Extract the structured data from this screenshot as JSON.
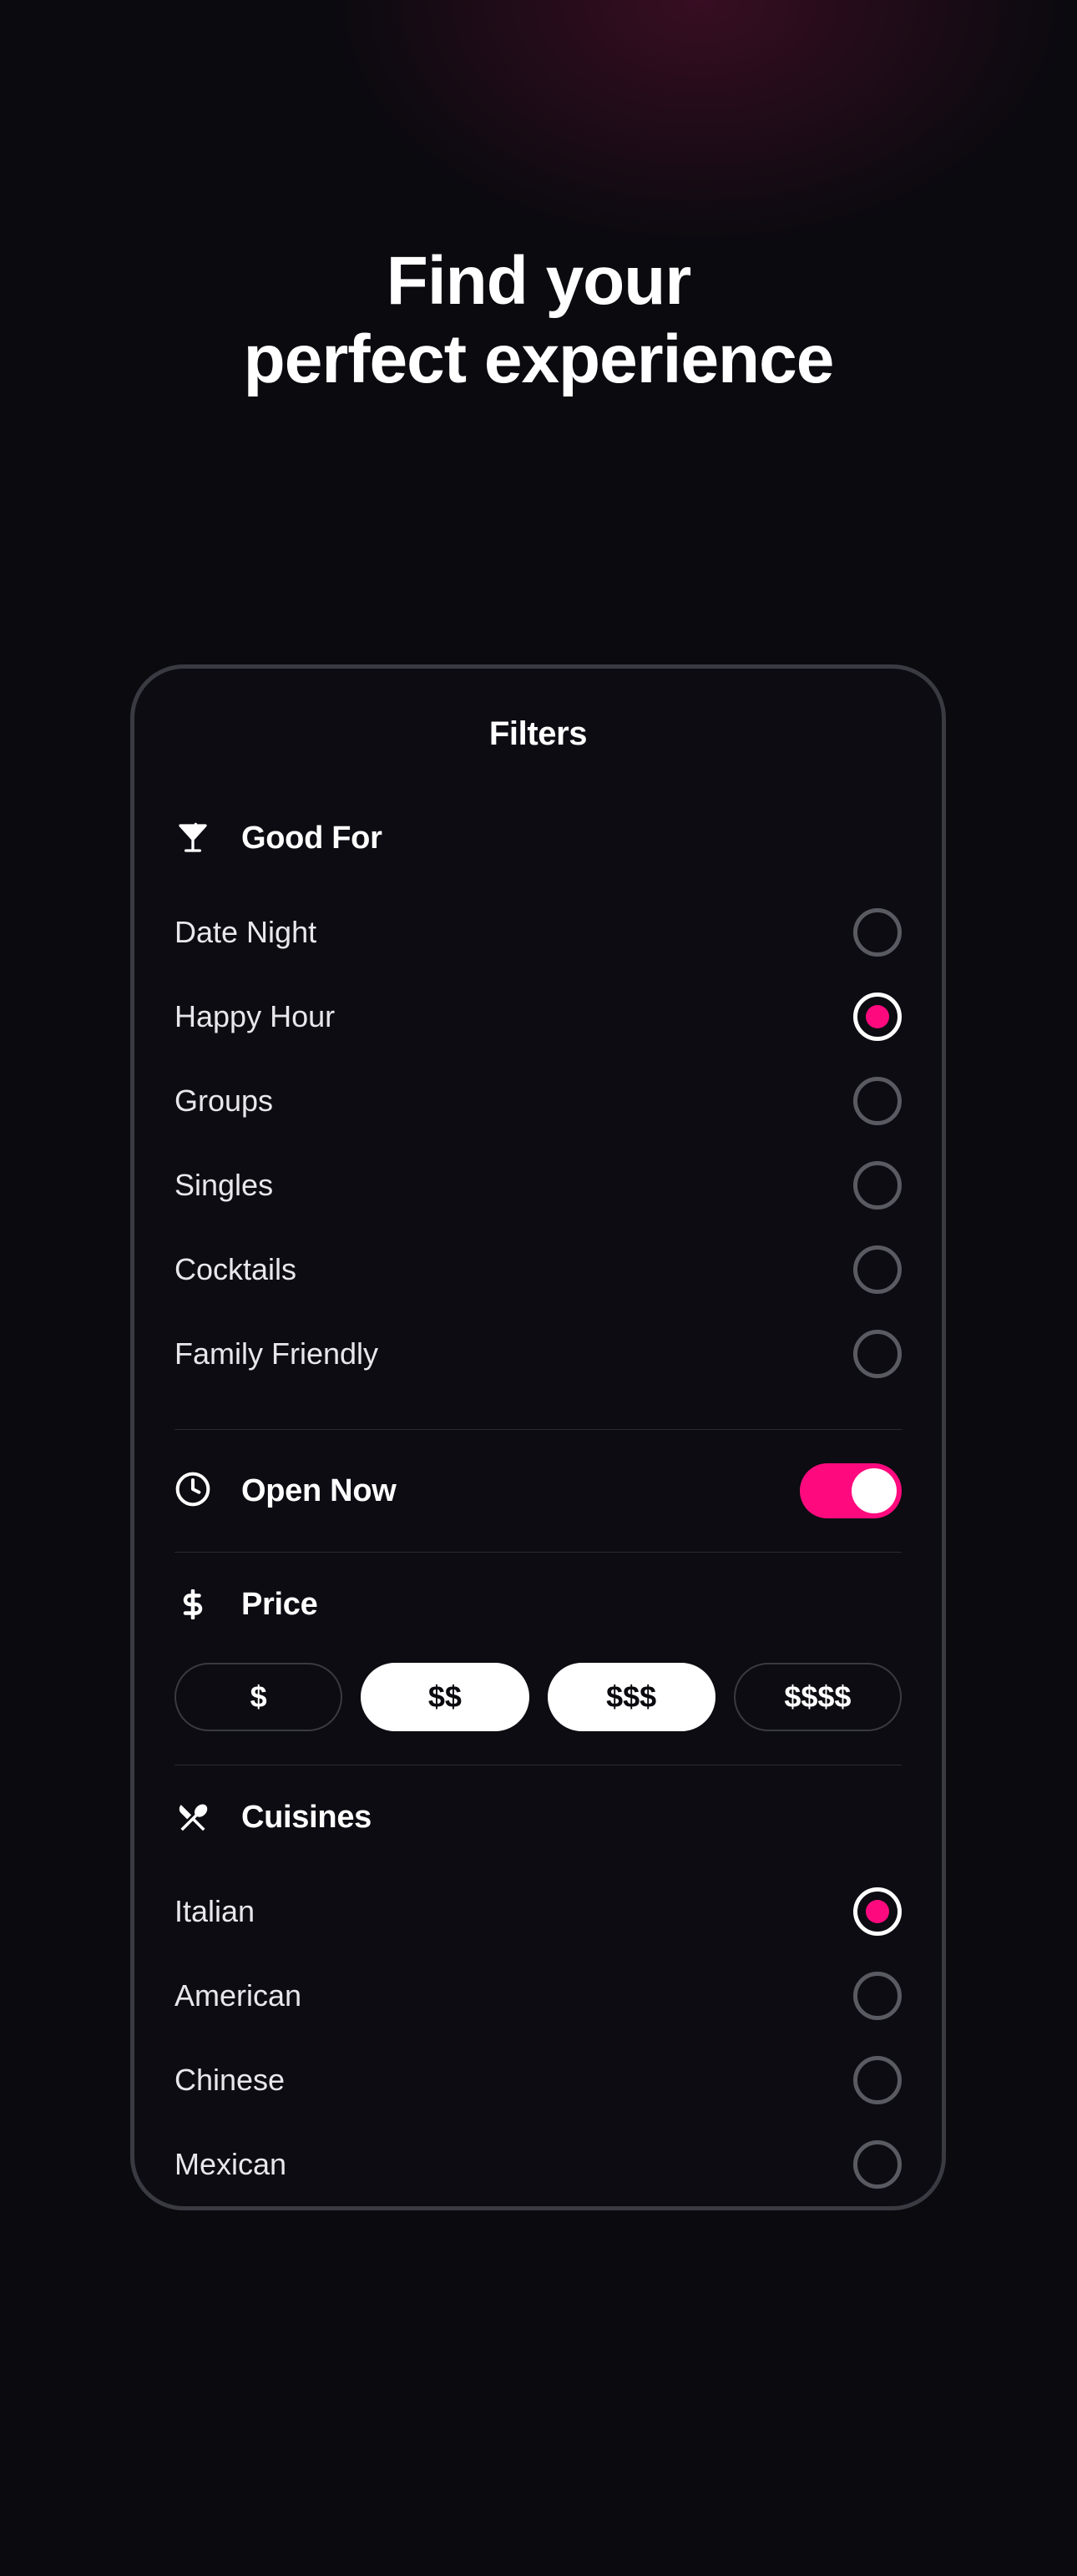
{
  "hero": {
    "line1": "Find your",
    "line2": "perfect experience"
  },
  "filters": {
    "title": "Filters",
    "goodFor": {
      "title": "Good For",
      "options": [
        {
          "label": "Date Night",
          "selected": false
        },
        {
          "label": "Happy Hour",
          "selected": true
        },
        {
          "label": "Groups",
          "selected": false
        },
        {
          "label": "Singles",
          "selected": false
        },
        {
          "label": "Cocktails",
          "selected": false
        },
        {
          "label": "Family Friendly",
          "selected": false
        }
      ]
    },
    "openNow": {
      "label": "Open Now",
      "enabled": true
    },
    "price": {
      "title": "Price",
      "options": [
        {
          "label": "$",
          "selected": false
        },
        {
          "label": "$$",
          "selected": true
        },
        {
          "label": "$$$",
          "selected": true
        },
        {
          "label": "$$$$",
          "selected": false
        }
      ]
    },
    "cuisines": {
      "title": "Cuisines",
      "options": [
        {
          "label": "Italian",
          "selected": true
        },
        {
          "label": "American",
          "selected": false
        },
        {
          "label": "Chinese",
          "selected": false
        },
        {
          "label": "Mexican",
          "selected": false
        }
      ]
    }
  },
  "colors": {
    "accent": "#ff0a7e",
    "background": "#0a0a0f"
  }
}
